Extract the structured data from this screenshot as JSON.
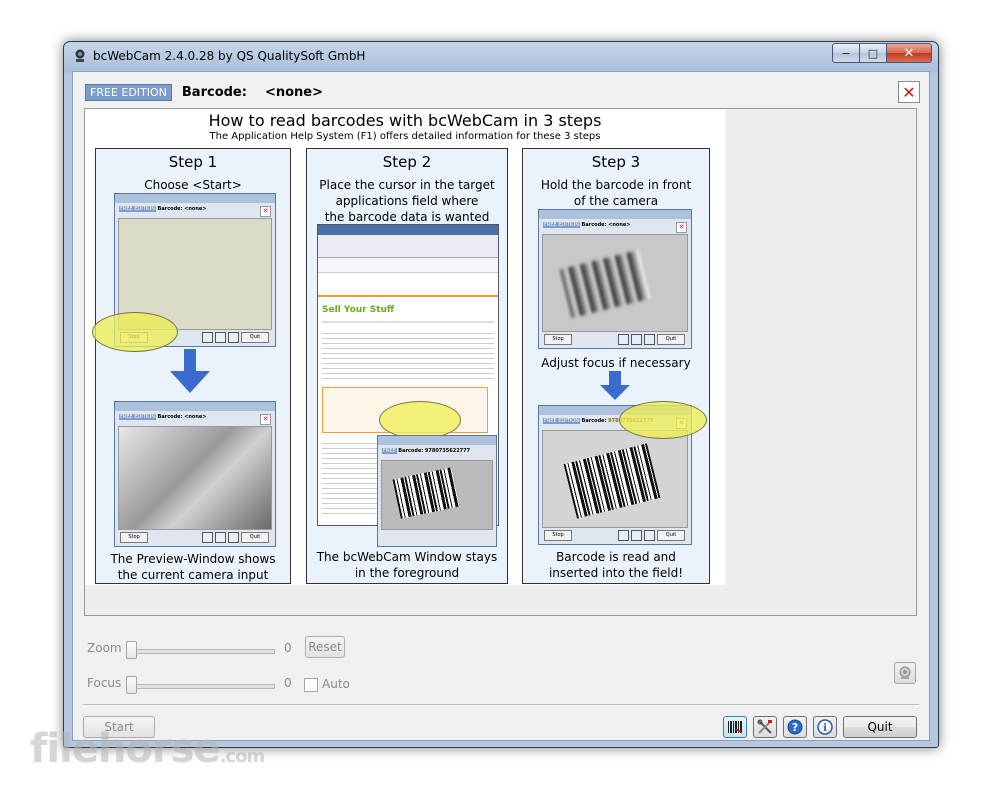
{
  "window": {
    "title": "bcWebCam 2.4.0.28 by QS QualitySoft GmbH",
    "minimize_glyph": "−",
    "maximize_glyph": "□",
    "close_glyph": "✕"
  },
  "header": {
    "edition_badge": "FREE EDITION",
    "barcode_label": "Barcode:",
    "barcode_value": "<none>",
    "close_glyph": "✕"
  },
  "help": {
    "title": "How to read barcodes with bcWebCam in 3 steps",
    "subtitle": "The Application Help System (F1) offers detailed information for these 3 steps",
    "steps": [
      {
        "title": "Step 1",
        "top_text": "Choose <Start>",
        "bottom_text_1": "The Preview-Window shows",
        "bottom_text_2": "the current camera input"
      },
      {
        "title": "Step 2",
        "top_text_1": "Place the cursor in the target",
        "top_text_2": "applications field where",
        "top_text_3": "the barcode data is wanted",
        "bottom_text_1": "The bcWebCam Window stays",
        "bottom_text_2": "in the foreground"
      },
      {
        "title": "Step 3",
        "top_text_1": "Hold the barcode in front",
        "top_text_2": "of the camera",
        "middle_text": "Adjust focus if necessary",
        "bottom_text_1": "Barcode is read and",
        "bottom_text_2": "inserted into the field!"
      }
    ]
  },
  "controls": {
    "zoom_label": "Zoom",
    "zoom_value": "0",
    "reset_label": "Reset",
    "focus_label": "Focus",
    "focus_value": "0",
    "auto_label": "Auto",
    "start_label": "Start",
    "quit_label": "Quit"
  },
  "watermark": {
    "text": "filehorse",
    "suffix": ".com"
  }
}
